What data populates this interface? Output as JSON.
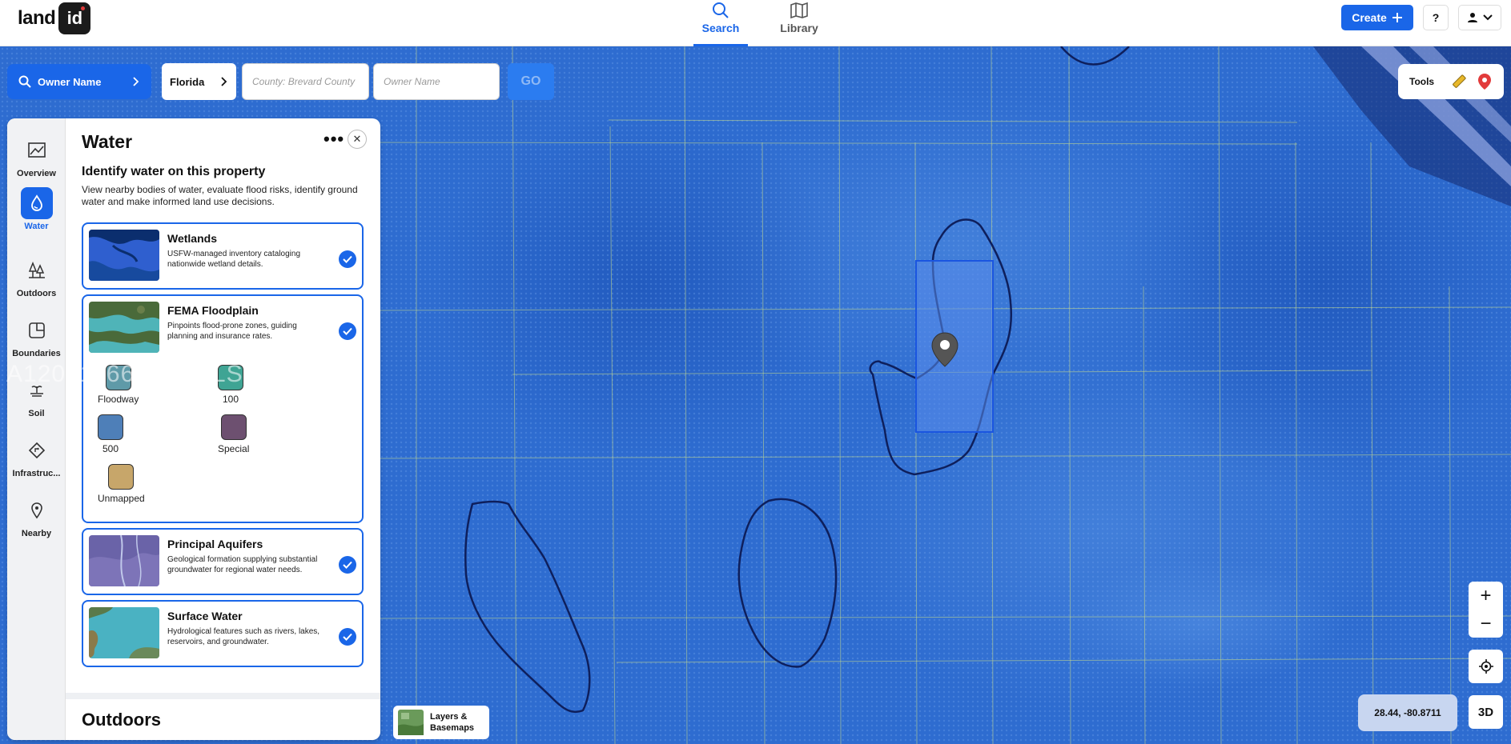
{
  "brand": {
    "word": "land",
    "badge": "id"
  },
  "nav": [
    {
      "label": "Search",
      "icon": "search-icon",
      "active": true
    },
    {
      "label": "Library",
      "icon": "map-icon",
      "active": false
    }
  ],
  "header": {
    "create_label": "Create",
    "help_label": "?"
  },
  "search": {
    "mode_label": "Owner Name",
    "state_value": "Florida",
    "county_placeholder": "County: Brevard County",
    "owner_placeholder": "Owner Name",
    "go_label": "GO"
  },
  "tools": {
    "label": "Tools"
  },
  "rail": [
    {
      "label": "Overview",
      "icon": "overview-icon"
    },
    {
      "label": "Water",
      "icon": "water-drop-icon",
      "active": true
    },
    {
      "label": "Outdoors",
      "icon": "trees-icon"
    },
    {
      "label": "Boundaries",
      "icon": "boundary-icon"
    },
    {
      "label": "Soil",
      "icon": "soil-icon"
    },
    {
      "label": "Infrastruc...",
      "icon": "infrastructure-icon"
    },
    {
      "label": "Nearby",
      "icon": "pin-icon"
    }
  ],
  "panel": {
    "title": "Water",
    "more_label": "•••",
    "close_label": "✕",
    "heading": "Identify water on this property",
    "description": "View nearby bodies of water, evaluate flood risks, identify ground water and make informed land use decisions.",
    "layers": [
      {
        "name": "Wetlands",
        "description": "USFW-managed inventory cataloging nationwide wetland details.",
        "checked": true
      },
      {
        "name": "FEMA Floodplain",
        "description": "Pinpoints flood-prone zones, guiding planning and insurance rates.",
        "checked": true
      },
      {
        "name": "Principal Aquifers",
        "description": "Geological formation supplying substantial groundwater for regional water needs.",
        "checked": true
      },
      {
        "name": "Surface Water",
        "description": "Hydrological features such as rivers, lakes, reservoirs, and groundwater.",
        "checked": true
      }
    ],
    "flood_legend": [
      {
        "label": "Floodway",
        "color": "#5f9aa8"
      },
      {
        "label": "100",
        "color": "#3fa494"
      },
      {
        "label": "500",
        "color": "#4e7fb8"
      },
      {
        "label": "Special",
        "color": "#6d5070"
      },
      {
        "label": "Unmapped",
        "color": "#c7a66a"
      }
    ],
    "next_section": "Outdoors"
  },
  "watermark": "A12071166  SEFMLS© 2026",
  "map": {
    "layers_label_line1": "Layers &",
    "layers_label_line2": "Basemaps",
    "coords": "28.44, -80.8711",
    "zoom_in": "+",
    "zoom_out": "−",
    "btn_3d": "3D"
  },
  "colors": {
    "accent": "#1a66e8",
    "map_water": "#2f6fd0",
    "parcel": "#4a86e8",
    "pin": "#e23b3b"
  }
}
